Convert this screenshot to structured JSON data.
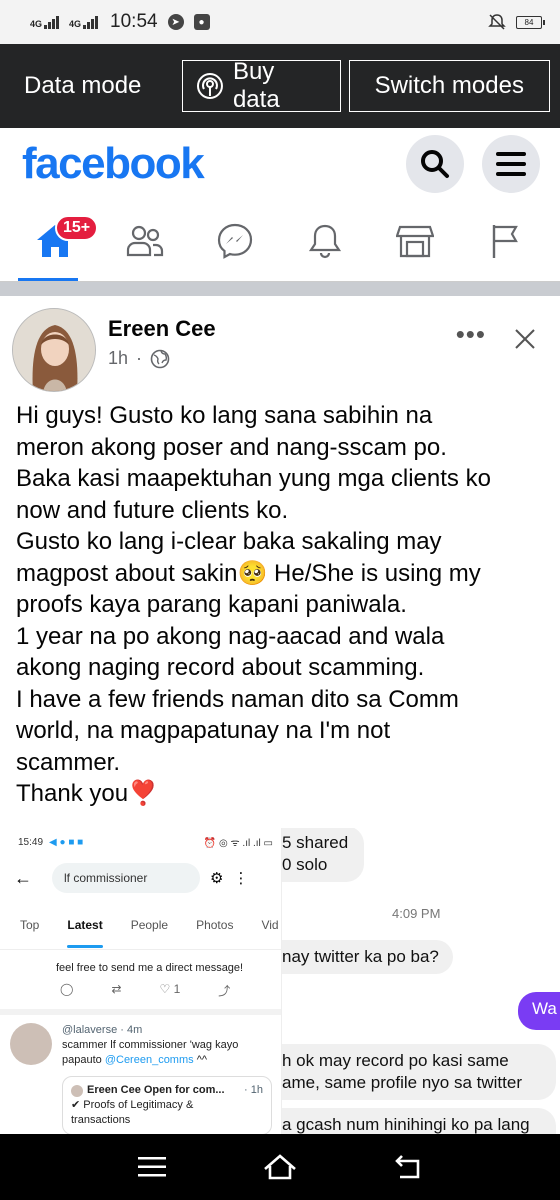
{
  "status_bar": {
    "signal1": "4G",
    "signal2": "4G",
    "time": "10:54",
    "battery": "84"
  },
  "data_bar": {
    "label": "Data mode",
    "buy_label": "Buy data",
    "switch_label": "Switch modes"
  },
  "header": {
    "logo": "facebook"
  },
  "nav": {
    "home_badge": "15+"
  },
  "post": {
    "author": "Ereen Cee",
    "time": "1h",
    "dot": "·",
    "text_lines": [
      "Hi guys! Gusto ko lang sana sabihin na",
      "meron akong poser and nang-sscam po.",
      "Baka kasi maapektuhan yung mga clients ko",
      "now and future clients ko.",
      "Gusto ko lang i-clear baka sakaling may",
      "magpost about sakin🥺 He/She is using my",
      "proofs kaya parang kapani paniwala.",
      "1 year na po akong nag-aacad and wala",
      "akong naging record about scamming.",
      "I have a few friends naman dito sa Comm",
      "world, na magpapatunay na I'm not",
      "scammer.",
      "Thank you❣️"
    ]
  },
  "image_left": {
    "time": "15:49",
    "search_text": "lf commissioner",
    "tabs": [
      "Top",
      "Latest",
      "People",
      "Photos",
      "Vid"
    ],
    "message": "feel free to send me a direct message!",
    "like_count": "1",
    "tweet_handle": "@lalaverse · 4m",
    "tweet_text_1": "scammer lf commissioner 'wag kayo",
    "tweet_text_2": "papauto",
    "tweet_mention": "@Cereen_comms",
    "tweet_suffix": "^^",
    "quote_title": "Ereen Cee Open for com...",
    "quote_time": "· 1h",
    "quote_line_1": "✔ Proofs of Legitimacy &",
    "quote_line_2": "transactions"
  },
  "image_right": {
    "bubble1_line1": "5 shared",
    "bubble1_line2": "0 solo",
    "chat_time": "4:09 PM",
    "bubble2": "nay twitter ka po ba?",
    "bubble_me": "Wa",
    "bubble3_line1": "h ok may record po kasi same",
    "bubble3_line2": "ame, same profile nyo sa twitter",
    "bubble4": "a gcash num hinihingi ko pa lang"
  },
  "colors": {
    "brand": "#1877f2",
    "badge": "#e41e3f",
    "messenger_bubble": "#7a3cf3"
  }
}
